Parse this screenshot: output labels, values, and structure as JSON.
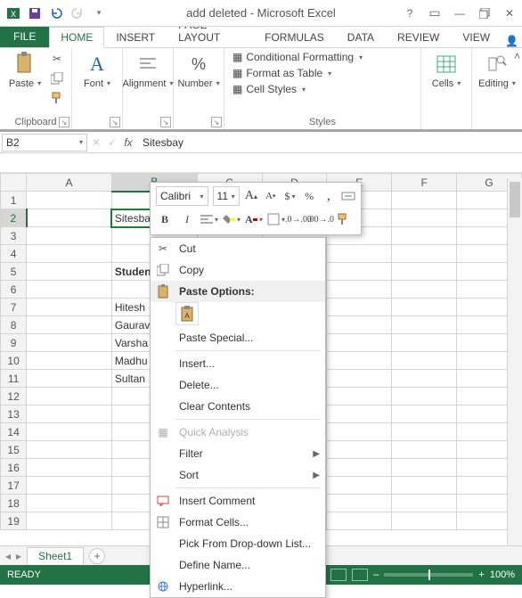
{
  "title": "add deleted - Microsoft Excel",
  "tabs": {
    "file": "FILE",
    "home": "HOME",
    "insert": "INSERT",
    "page": "PAGE LAYOUT",
    "formulas": "FORMULAS",
    "data": "DATA",
    "review": "REVIEW",
    "view": "VIEW"
  },
  "ribbon": {
    "clipboard": {
      "label": "Clipboard",
      "paste": "Paste"
    },
    "font": {
      "label": "Font",
      "btn": "Font"
    },
    "alignment": {
      "label": "Alignment"
    },
    "number": {
      "label": "Number"
    },
    "styles": {
      "label": "Styles",
      "cond": "Conditional Formatting",
      "table": "Format as Table",
      "cell": "Cell Styles"
    },
    "cells": {
      "label": "Cells"
    },
    "editing": {
      "label": "Editing"
    }
  },
  "namebox": "B2",
  "formula_value": "Sitesbay",
  "columns": [
    "A",
    "B",
    "C",
    "D",
    "E",
    "F",
    "G"
  ],
  "rows_count": 19,
  "cells": {
    "B2": "Sitesbay",
    "B5": "Student Name",
    "B7": "Hitesh",
    "B8": "Gaurav",
    "B9": "Varsha",
    "B10": "Madhu",
    "B11": "Sultan"
  },
  "active_col": "B",
  "active_row": 2,
  "sheet": "Sheet1",
  "status": "READY",
  "zoom": "100%",
  "mini": {
    "font": "Calibri",
    "size": "11"
  },
  "context": {
    "cut": "Cut",
    "copy": "Copy",
    "paste_options": "Paste Options:",
    "paste_special": "Paste Special...",
    "insert": "Insert...",
    "delete": "Delete...",
    "clear": "Clear Contents",
    "quick": "Quick Analysis",
    "filter": "Filter",
    "sort": "Sort",
    "comment": "Insert Comment",
    "format_cells": "Format Cells...",
    "pick": "Pick From Drop-down List...",
    "define": "Define Name...",
    "hyperlink": "Hyperlink..."
  }
}
